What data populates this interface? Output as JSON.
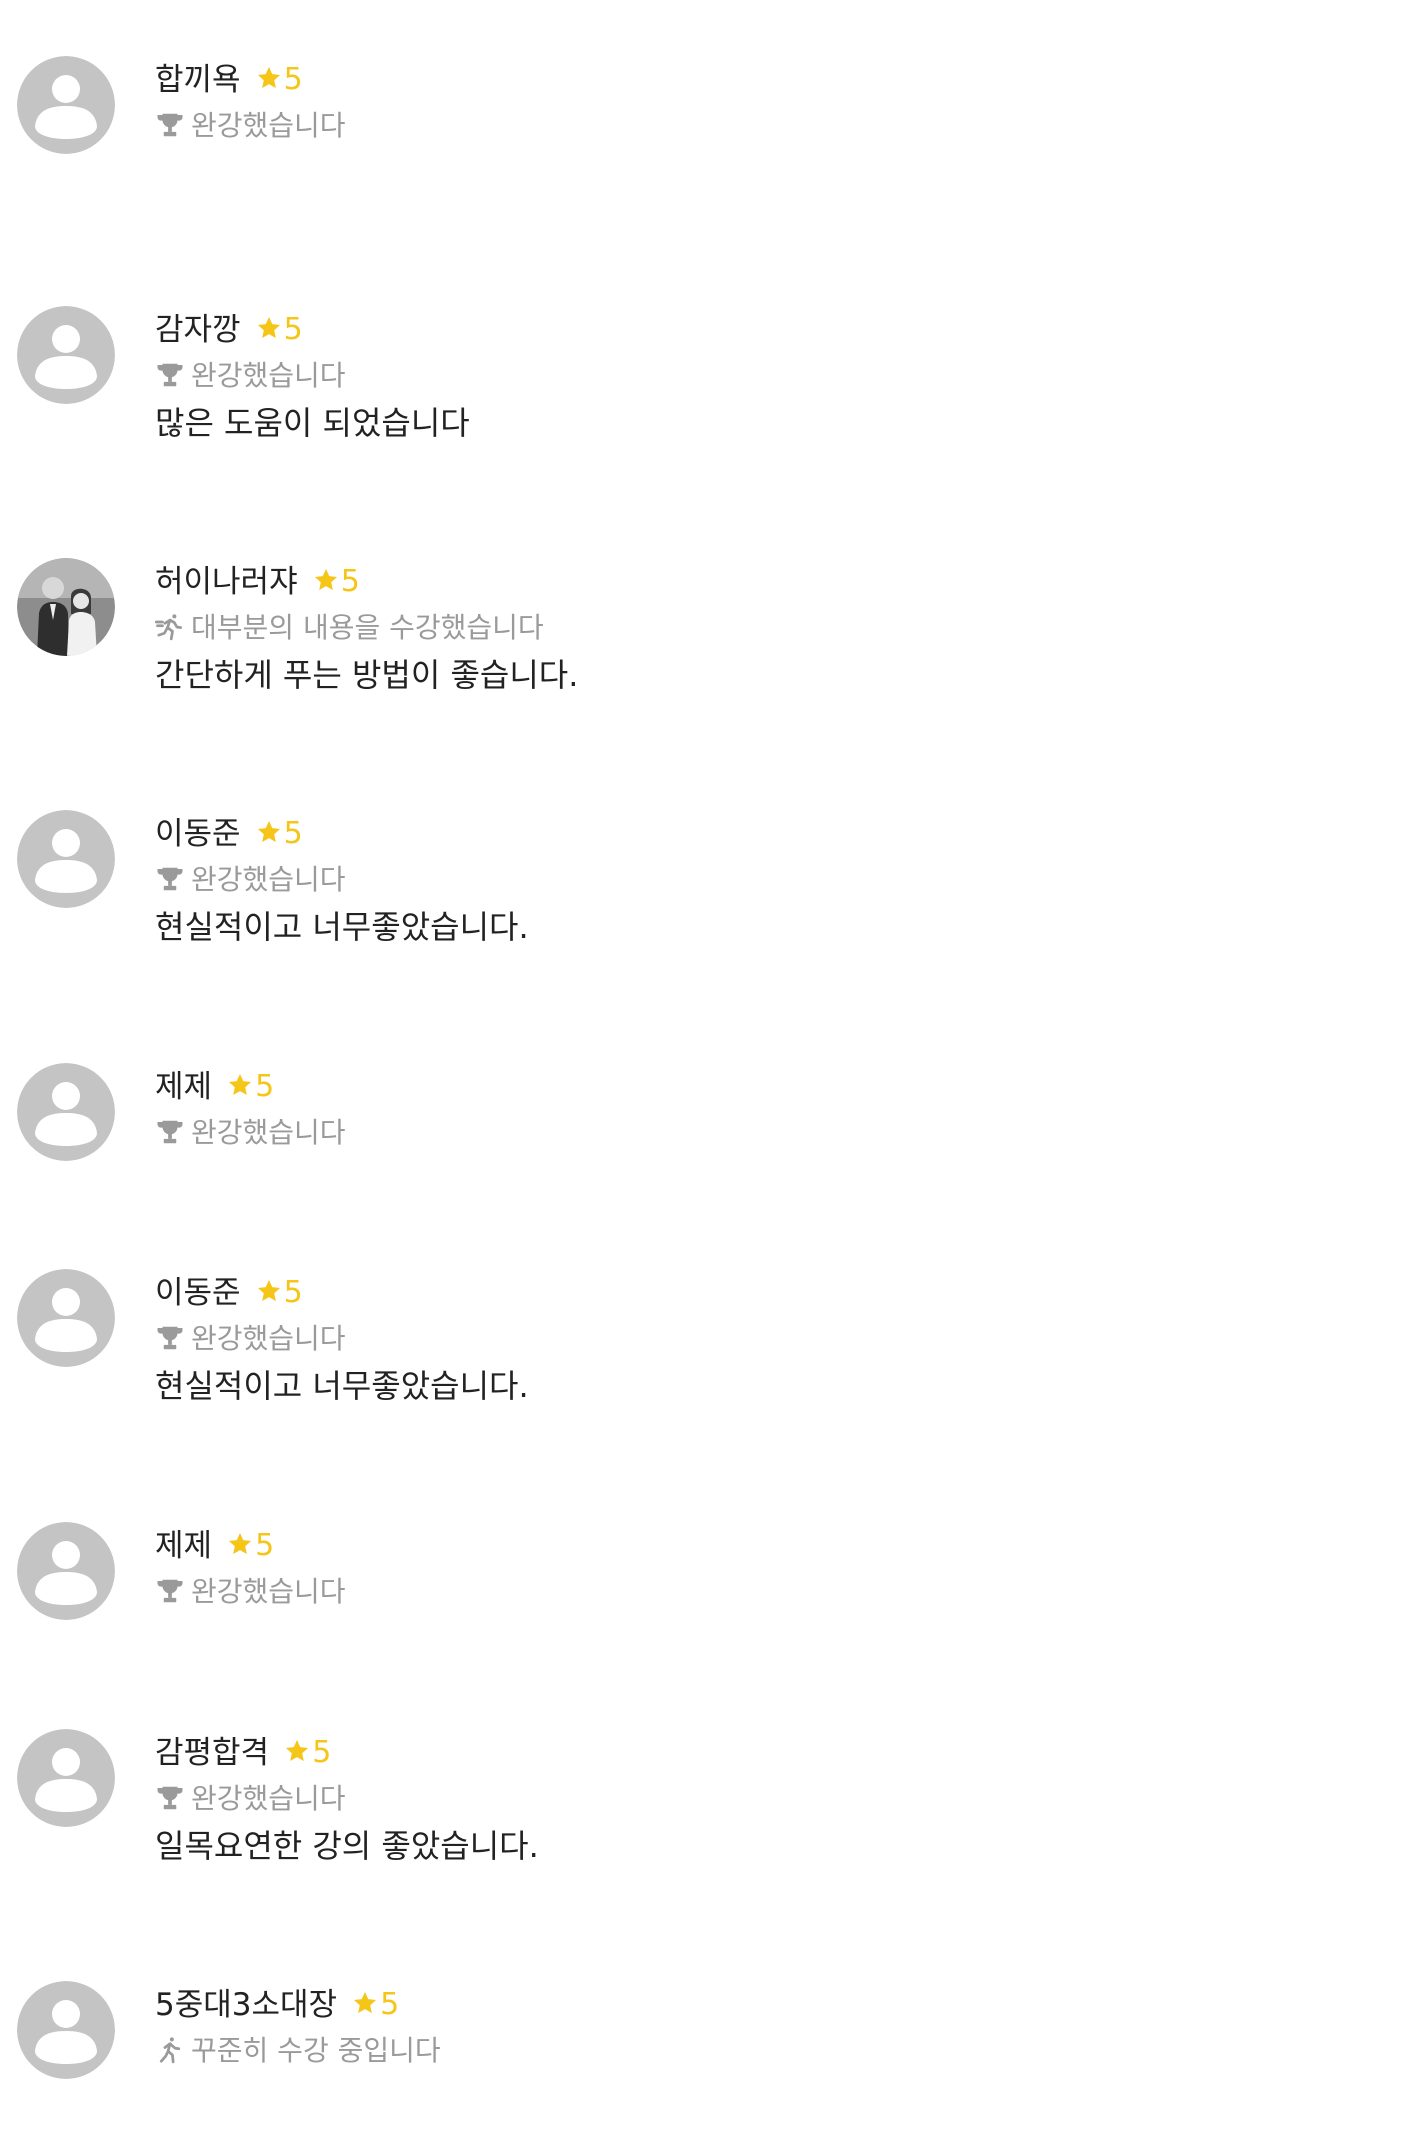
{
  "colors": {
    "star": "#F5C518",
    "avatar_placeholder": "#c4c4c4",
    "muted_text": "#9a9a9a",
    "text": "#222222"
  },
  "reviews": [
    {
      "name": "합끼욕",
      "rating": "5",
      "status_icon": "trophy-icon",
      "status": "완강했습니다",
      "comment": "",
      "avatar": "default-avatar"
    },
    {
      "name": "감자깡",
      "rating": "5",
      "status_icon": "trophy-icon",
      "status": "완강했습니다",
      "comment": "많은 도움이 되었습니다",
      "avatar": "default-avatar"
    },
    {
      "name": "허이나러쟈",
      "rating": "5",
      "status_icon": "running-person-icon",
      "status": "대부분의 내용을 수강했습니다",
      "comment": "간단하게 푸는 방법이 좋습니다.",
      "avatar": "profile-photo"
    },
    {
      "name": "이동준",
      "rating": "5",
      "status_icon": "trophy-icon",
      "status": "완강했습니다",
      "comment": "현실적이고 너무좋았습니다.",
      "avatar": "default-avatar"
    },
    {
      "name": "제제",
      "rating": "5",
      "status_icon": "trophy-icon",
      "status": "완강했습니다",
      "comment": "",
      "avatar": "default-avatar"
    },
    {
      "name": "이동준",
      "rating": "5",
      "status_icon": "trophy-icon",
      "status": "완강했습니다",
      "comment": "현실적이고 너무좋았습니다.",
      "avatar": "default-avatar"
    },
    {
      "name": "제제",
      "rating": "5",
      "status_icon": "trophy-icon",
      "status": "완강했습니다",
      "comment": "",
      "avatar": "default-avatar"
    },
    {
      "name": "감평합격",
      "rating": "5",
      "status_icon": "trophy-icon",
      "status": "완강했습니다",
      "comment": "일목요연한 강의 좋았습니다.",
      "avatar": "default-avatar"
    },
    {
      "name": "5중대3소대장",
      "rating": "5",
      "status_icon": "walking-person-icon",
      "status": "꾸준히 수강 중입니다",
      "comment": "",
      "avatar": "default-avatar"
    }
  ]
}
